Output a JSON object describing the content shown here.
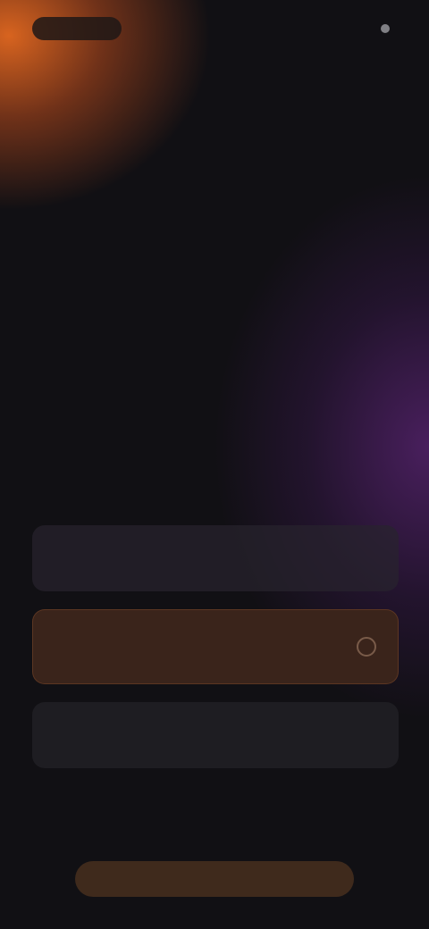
{
  "header": {
    "status_text": ""
  },
  "top_subtitle": "",
  "hero": {
    "title": "",
    "subtitle": ""
  },
  "options": [
    {
      "label": ""
    },
    {
      "label": ""
    },
    {
      "label": ""
    }
  ],
  "cta": {
    "label": ""
  },
  "colors": {
    "background": "#111014",
    "accent_orange": "#e26820",
    "accent_purple": "#5c2476",
    "selected_card": "#3a241b"
  }
}
